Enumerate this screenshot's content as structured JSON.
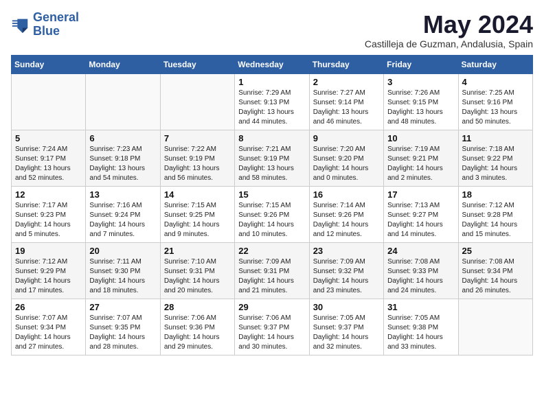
{
  "logo": {
    "line1": "General",
    "line2": "Blue"
  },
  "title": "May 2024",
  "subtitle": "Castilleja de Guzman, Andalusia, Spain",
  "days_of_week": [
    "Sunday",
    "Monday",
    "Tuesday",
    "Wednesday",
    "Thursday",
    "Friday",
    "Saturday"
  ],
  "weeks": [
    [
      {
        "num": "",
        "info": ""
      },
      {
        "num": "",
        "info": ""
      },
      {
        "num": "",
        "info": ""
      },
      {
        "num": "1",
        "info": "Sunrise: 7:29 AM\nSunset: 9:13 PM\nDaylight: 13 hours and 44 minutes."
      },
      {
        "num": "2",
        "info": "Sunrise: 7:27 AM\nSunset: 9:14 PM\nDaylight: 13 hours and 46 minutes."
      },
      {
        "num": "3",
        "info": "Sunrise: 7:26 AM\nSunset: 9:15 PM\nDaylight: 13 hours and 48 minutes."
      },
      {
        "num": "4",
        "info": "Sunrise: 7:25 AM\nSunset: 9:16 PM\nDaylight: 13 hours and 50 minutes."
      }
    ],
    [
      {
        "num": "5",
        "info": "Sunrise: 7:24 AM\nSunset: 9:17 PM\nDaylight: 13 hours and 52 minutes."
      },
      {
        "num": "6",
        "info": "Sunrise: 7:23 AM\nSunset: 9:18 PM\nDaylight: 13 hours and 54 minutes."
      },
      {
        "num": "7",
        "info": "Sunrise: 7:22 AM\nSunset: 9:19 PM\nDaylight: 13 hours and 56 minutes."
      },
      {
        "num": "8",
        "info": "Sunrise: 7:21 AM\nSunset: 9:19 PM\nDaylight: 13 hours and 58 minutes."
      },
      {
        "num": "9",
        "info": "Sunrise: 7:20 AM\nSunset: 9:20 PM\nDaylight: 14 hours and 0 minutes."
      },
      {
        "num": "10",
        "info": "Sunrise: 7:19 AM\nSunset: 9:21 PM\nDaylight: 14 hours and 2 minutes."
      },
      {
        "num": "11",
        "info": "Sunrise: 7:18 AM\nSunset: 9:22 PM\nDaylight: 14 hours and 3 minutes."
      }
    ],
    [
      {
        "num": "12",
        "info": "Sunrise: 7:17 AM\nSunset: 9:23 PM\nDaylight: 14 hours and 5 minutes."
      },
      {
        "num": "13",
        "info": "Sunrise: 7:16 AM\nSunset: 9:24 PM\nDaylight: 14 hours and 7 minutes."
      },
      {
        "num": "14",
        "info": "Sunrise: 7:15 AM\nSunset: 9:25 PM\nDaylight: 14 hours and 9 minutes."
      },
      {
        "num": "15",
        "info": "Sunrise: 7:15 AM\nSunset: 9:26 PM\nDaylight: 14 hours and 10 minutes."
      },
      {
        "num": "16",
        "info": "Sunrise: 7:14 AM\nSunset: 9:26 PM\nDaylight: 14 hours and 12 minutes."
      },
      {
        "num": "17",
        "info": "Sunrise: 7:13 AM\nSunset: 9:27 PM\nDaylight: 14 hours and 14 minutes."
      },
      {
        "num": "18",
        "info": "Sunrise: 7:12 AM\nSunset: 9:28 PM\nDaylight: 14 hours and 15 minutes."
      }
    ],
    [
      {
        "num": "19",
        "info": "Sunrise: 7:12 AM\nSunset: 9:29 PM\nDaylight: 14 hours and 17 minutes."
      },
      {
        "num": "20",
        "info": "Sunrise: 7:11 AM\nSunset: 9:30 PM\nDaylight: 14 hours and 18 minutes."
      },
      {
        "num": "21",
        "info": "Sunrise: 7:10 AM\nSunset: 9:31 PM\nDaylight: 14 hours and 20 minutes."
      },
      {
        "num": "22",
        "info": "Sunrise: 7:09 AM\nSunset: 9:31 PM\nDaylight: 14 hours and 21 minutes."
      },
      {
        "num": "23",
        "info": "Sunrise: 7:09 AM\nSunset: 9:32 PM\nDaylight: 14 hours and 23 minutes."
      },
      {
        "num": "24",
        "info": "Sunrise: 7:08 AM\nSunset: 9:33 PM\nDaylight: 14 hours and 24 minutes."
      },
      {
        "num": "25",
        "info": "Sunrise: 7:08 AM\nSunset: 9:34 PM\nDaylight: 14 hours and 26 minutes."
      }
    ],
    [
      {
        "num": "26",
        "info": "Sunrise: 7:07 AM\nSunset: 9:34 PM\nDaylight: 14 hours and 27 minutes."
      },
      {
        "num": "27",
        "info": "Sunrise: 7:07 AM\nSunset: 9:35 PM\nDaylight: 14 hours and 28 minutes."
      },
      {
        "num": "28",
        "info": "Sunrise: 7:06 AM\nSunset: 9:36 PM\nDaylight: 14 hours and 29 minutes."
      },
      {
        "num": "29",
        "info": "Sunrise: 7:06 AM\nSunset: 9:37 PM\nDaylight: 14 hours and 30 minutes."
      },
      {
        "num": "30",
        "info": "Sunrise: 7:05 AM\nSunset: 9:37 PM\nDaylight: 14 hours and 32 minutes."
      },
      {
        "num": "31",
        "info": "Sunrise: 7:05 AM\nSunset: 9:38 PM\nDaylight: 14 hours and 33 minutes."
      },
      {
        "num": "",
        "info": ""
      }
    ]
  ]
}
